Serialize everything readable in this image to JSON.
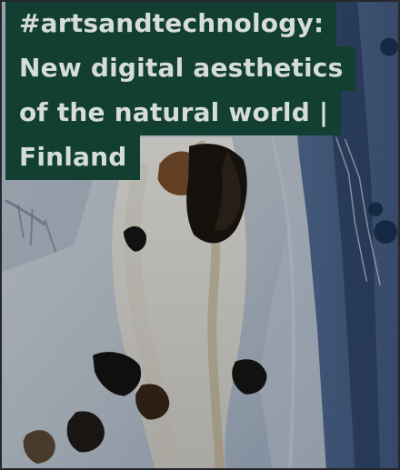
{
  "article_card": {
    "title_lines": [
      "#artsandtechnology:",
      "New digital aesthetics",
      "of the natural world |",
      "Finland"
    ],
    "accent_color": "#123f32",
    "text_color": "#d6ddd9"
  },
  "image": {
    "subject": "aerial view of snowy creek with dark trees",
    "icon": "photo-image"
  }
}
